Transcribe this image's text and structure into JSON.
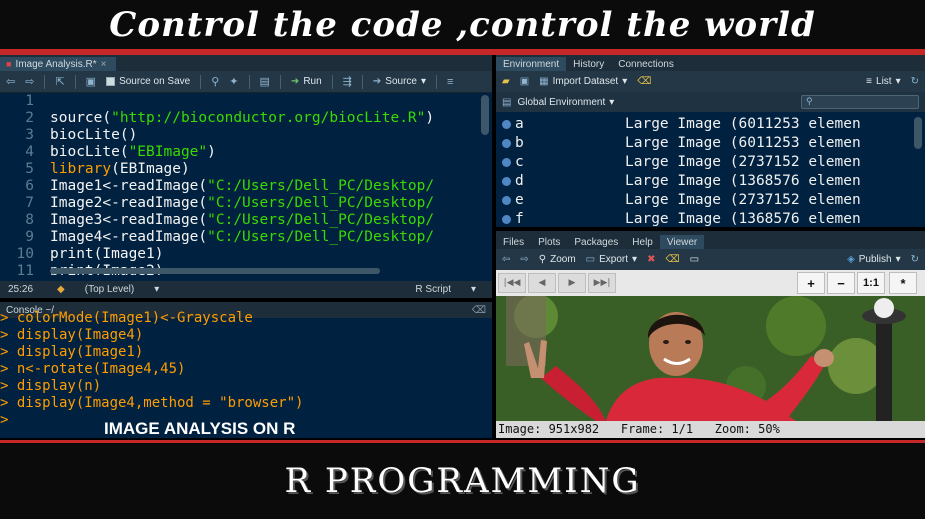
{
  "banner": {
    "top_text": "Control the code ,control the world",
    "bottom_text": "R PROGRAMMING"
  },
  "source_pane": {
    "tab_label": "Image Analysis.R*",
    "toolbar": {
      "source_on_save": "Source on Save",
      "run": "Run",
      "source": "Source"
    },
    "line_numbers": [
      "1",
      "2",
      "3",
      "4",
      "5",
      "6",
      "7",
      "8",
      "9",
      "10",
      "11"
    ],
    "code_lines": [
      [],
      [
        [
          "fn",
          "source("
        ],
        [
          "str",
          "\"http://bioconductor.org/biocLite.R\""
        ],
        [
          "fn",
          ")"
        ]
      ],
      [
        [
          "fn",
          "biocLite()"
        ]
      ],
      [
        [
          "fn",
          "biocLite("
        ],
        [
          "str",
          "\"EBImage\""
        ],
        [
          "fn",
          ")"
        ]
      ],
      [
        [
          "kw",
          "library"
        ],
        [
          "fn",
          "(EBImage)"
        ]
      ],
      [
        [
          "fn",
          "Image1<-readImage("
        ],
        [
          "str",
          "\"C:/Users/Dell_PC/Desktop/"
        ]
      ],
      [
        [
          "fn",
          "Image2<-readImage("
        ],
        [
          "str",
          "\"C:/Users/Dell_PC/Desktop/"
        ]
      ],
      [
        [
          "fn",
          "Image3<-readImage("
        ],
        [
          "str",
          "\"C:/Users/Dell_PC/Desktop/"
        ]
      ],
      [
        [
          "fn",
          "Image4<-readImage("
        ],
        [
          "str",
          "\"C:/Users/Dell_PC/Desktop/"
        ]
      ],
      [
        [
          "fn",
          "print(Image1)"
        ]
      ],
      [
        [
          "fn",
          "print(Image2)"
        ]
      ]
    ],
    "status": {
      "position": "25:26",
      "scope": "(Top Level)",
      "file_type": "R Script"
    }
  },
  "console_pane": {
    "title": "Console ~/",
    "lines": [
      "> colorMode(Image1)<-Grayscale",
      "> display(Image4)",
      "> display(Image1)",
      "> n<-rotate(Image4,45)",
      "> display(n)",
      "> display(Image4,method = \"browser\")",
      "> "
    ],
    "caption": "IMAGE ANALYSIS ON R"
  },
  "environment_pane": {
    "tabs": [
      "Environment",
      "History",
      "Connections"
    ],
    "toolbar": {
      "import_dataset": "Import Dataset",
      "list_view": "List"
    },
    "scope": "Global Environment",
    "rows": [
      {
        "name": "a",
        "value": "Large Image (6011253 elemen"
      },
      {
        "name": "b",
        "value": "Large Image (6011253 elemen"
      },
      {
        "name": "c",
        "value": "Large Image (2737152 elemen"
      },
      {
        "name": "d",
        "value": "Large Image (1368576 elemen"
      },
      {
        "name": "e",
        "value": "Large Image (2737152 elemen"
      },
      {
        "name": "f",
        "value": "Large Image (1368576 elemen"
      }
    ]
  },
  "viewer_pane": {
    "tabs": [
      "Files",
      "Plots",
      "Packages",
      "Help",
      "Viewer"
    ],
    "toolbar": {
      "zoom": "Zoom",
      "export": "Export",
      "publish": "Publish"
    },
    "zoom_buttons": [
      "+",
      "−",
      "1:1",
      "*"
    ],
    "info": {
      "image": "Image: 951x982",
      "frame": "Frame: 1/1",
      "zoom": "Zoom: 50%"
    }
  }
}
